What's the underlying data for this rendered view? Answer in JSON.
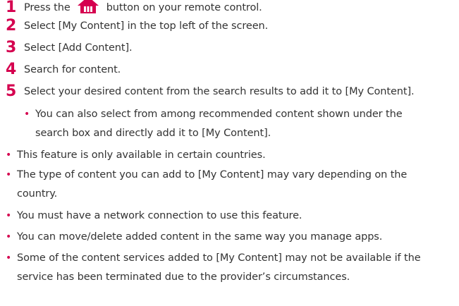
{
  "steps": [
    {
      "num": "1",
      "text_before": "Press the",
      "icon": "home-icon",
      "text_after": "button on your remote control."
    },
    {
      "num": "2",
      "text": "Select [My Content] in the top left of the screen."
    },
    {
      "num": "3",
      "text": "Select [Add Content]."
    },
    {
      "num": "4",
      "text": "Search for content."
    },
    {
      "num": "5",
      "text": "Select your desired content from the search results to add it to [My Content]."
    }
  ],
  "sub_note": {
    "line1": "You can also select from among recommended content shown under the",
    "line2": "search box and directly add it to [My Content]."
  },
  "notes": [
    {
      "lines": [
        "This feature is only available in certain countries."
      ]
    },
    {
      "lines": [
        "The type of content you can add to [My Content] may vary depending on the",
        "country."
      ]
    },
    {
      "lines": [
        "You must have a network connection to use this feature."
      ]
    },
    {
      "lines": [
        "You can move/delete added content in the same way you manage apps."
      ]
    },
    {
      "lines": [
        "Some of the content services added to [My Content] may not be available if the",
        "service has been terminated due to the provider’s circumstances."
      ]
    }
  ],
  "colors": {
    "accent": "#d5004f",
    "text": "#333333"
  }
}
